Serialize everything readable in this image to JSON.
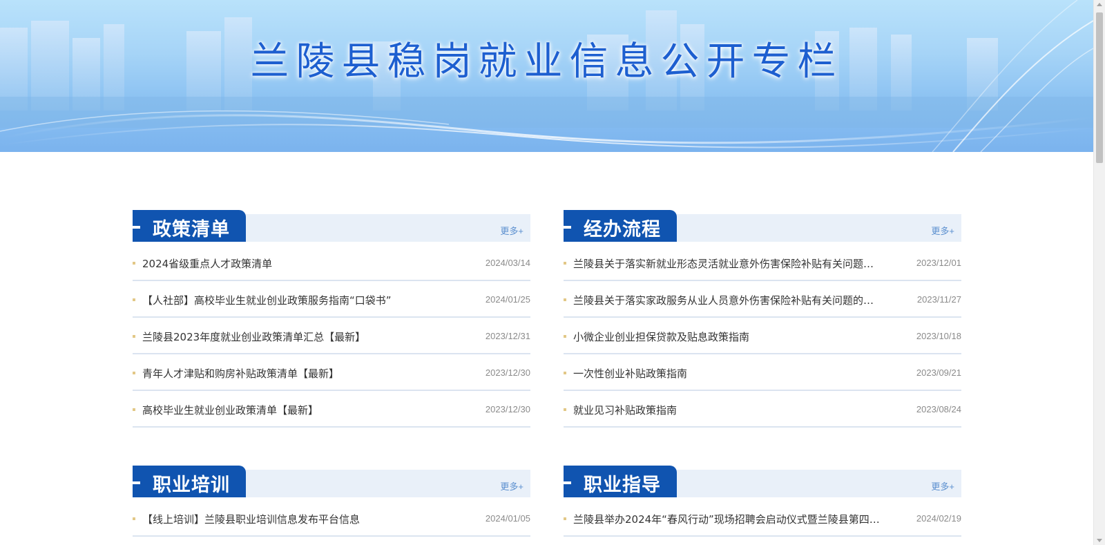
{
  "banner": {
    "title": "兰陵县稳岗就业信息公开专栏"
  },
  "more_label": "更多+",
  "panels": [
    {
      "title": "政策清单",
      "items": [
        {
          "title": "2024省级重点人才政策清单",
          "date": "2024/03/14"
        },
        {
          "title": "【人社部】高校毕业生就业创业政策服务指南“口袋书”",
          "date": "2024/01/25"
        },
        {
          "title": "兰陵县2023年度就业创业政策清单汇总【最新】",
          "date": "2023/12/31"
        },
        {
          "title": "青年人才津贴和购房补贴政策清单【最新】",
          "date": "2023/12/30"
        },
        {
          "title": "高校毕业生就业创业政策清单【最新】",
          "date": "2023/12/30"
        }
      ]
    },
    {
      "title": "经办流程",
      "items": [
        {
          "title": "兰陵县关于落实新就业形态灵活就业意外伤害保险补贴有关问题…",
          "date": "2023/12/01"
        },
        {
          "title": "兰陵县关于落实家政服务从业人员意外伤害保险补贴有关问题的…",
          "date": "2023/11/27"
        },
        {
          "title": "小微企业创业担保贷款及贴息政策指南",
          "date": "2023/10/18"
        },
        {
          "title": "一次性创业补贴政策指南",
          "date": "2023/09/21"
        },
        {
          "title": "就业见习补贴政策指南",
          "date": "2023/08/24"
        }
      ]
    },
    {
      "title": "职业培训",
      "items": [
        {
          "title": "【线上培训】兰陵县职业培训信息发布平台信息",
          "date": "2024/01/05"
        }
      ]
    },
    {
      "title": "职业指导",
      "items": [
        {
          "title": "兰陵县举办2024年“春风行动”现场招聘会启动仪式暨兰陵县第四…",
          "date": "2024/02/19"
        }
      ]
    }
  ]
}
